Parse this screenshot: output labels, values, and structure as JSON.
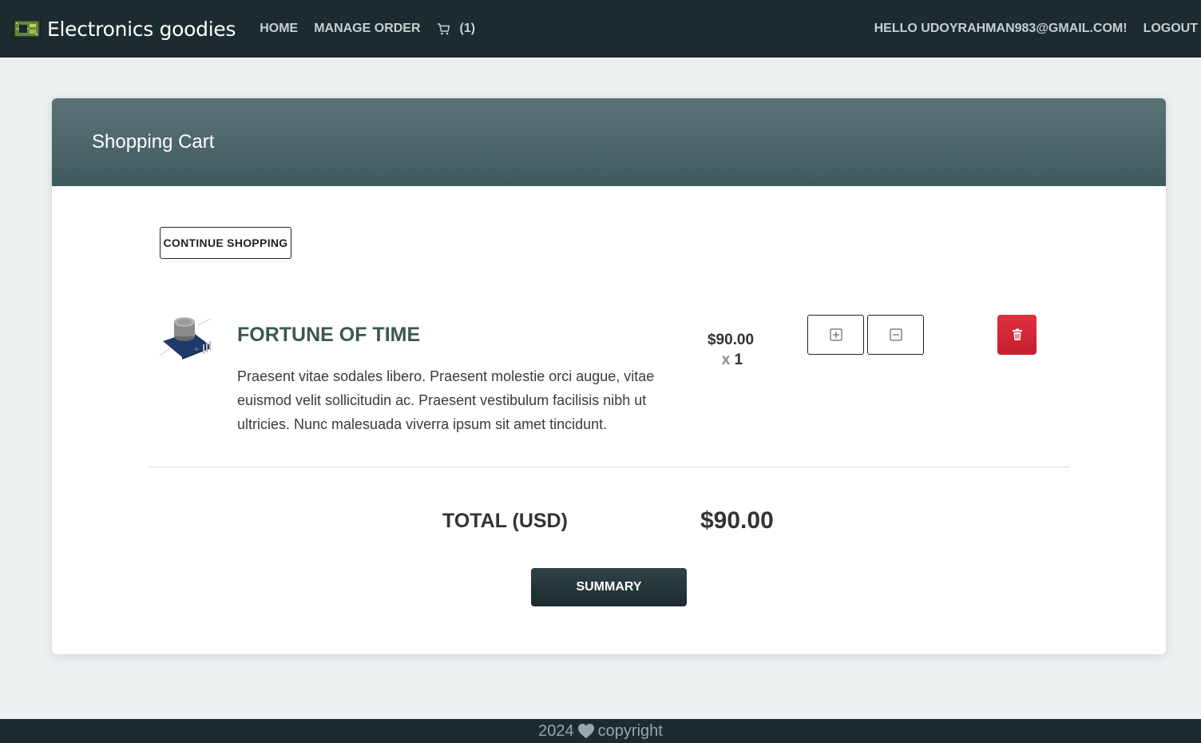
{
  "navbar": {
    "brand": "Electronics goodies",
    "home": "HOME",
    "manage_order": "MANAGE ORDER",
    "cart_count": "(1)",
    "greeting": "HELLO UDOYRAHMAN983@GMAIL.COM!",
    "logout": "LOGOUT",
    "icons": [
      "circuit-board-icon",
      "cart-icon"
    ]
  },
  "cart": {
    "title": "Shopping Cart",
    "continue_label": "CONTINUE SHOPPING",
    "items": [
      {
        "title": "FORTUNE OF TIME",
        "description": "Praesent vitae sodales libero. Praesent molestie orci augue, vitae euismod velit sollicitudin ac. Praesent vestibulum facilisis nibh ut ultricies. Nunc malesuada viverra ipsum sit amet tincidunt.",
        "price": "$90.00",
        "qty_prefix": "x",
        "qty": "1"
      }
    ],
    "total_label": "TOTAL (USD)",
    "total_value": "$90.00",
    "summary_label": "SUMMARY"
  },
  "footer": {
    "year": "2024",
    "text": "copyright"
  },
  "colors": {
    "navbar_bg": "#1b2b2f",
    "header_gradient_top": "#5b7377",
    "header_gradient_bottom": "#3f5a5e",
    "item_title": "#3b5a48",
    "delete": "#d32635"
  }
}
